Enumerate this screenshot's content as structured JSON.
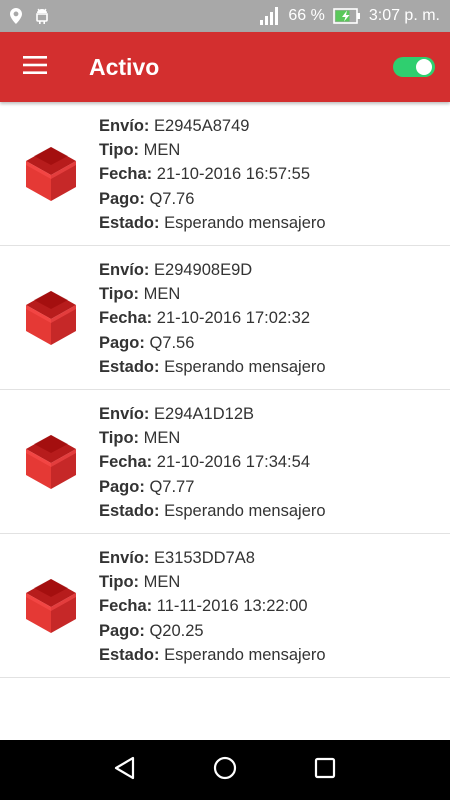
{
  "status_bar": {
    "battery_percent": "66 %",
    "time": "3:07 p. m.",
    "icons": [
      "location-icon",
      "android-icon",
      "signal-icon",
      "battery-charging-icon"
    ]
  },
  "app_bar": {
    "title": "Activo",
    "menu_icon": "hamburger-menu-icon",
    "toggle_on": true,
    "accent_color": "#d32f2f",
    "toggle_color": "#2fcf6f"
  },
  "labels": {
    "envio": "Envío:",
    "tipo": "Tipo:",
    "fecha": "Fecha:",
    "pago": "Pago:",
    "estado": "Estado:"
  },
  "shipments": [
    {
      "envio": "E2945A8749",
      "tipo": "MEN",
      "fecha": "21-10-2016 16:57:55",
      "pago": "Q7.76",
      "estado": "Esperando mensajero"
    },
    {
      "envio": "E294908E9D",
      "tipo": "MEN",
      "fecha": "21-10-2016 17:02:32",
      "pago": "Q7.56",
      "estado": "Esperando mensajero"
    },
    {
      "envio": "E294A1D12B",
      "tipo": "MEN",
      "fecha": "21-10-2016 17:34:54",
      "pago": "Q7.77",
      "estado": "Esperando mensajero"
    },
    {
      "envio": "E3153DD7A8",
      "tipo": "MEN",
      "fecha": "11-11-2016 13:22:00",
      "pago": "Q20.25",
      "estado": "Esperando mensajero"
    }
  ],
  "nav_bar": {
    "icons": [
      "back-icon",
      "home-icon",
      "recents-icon"
    ]
  }
}
